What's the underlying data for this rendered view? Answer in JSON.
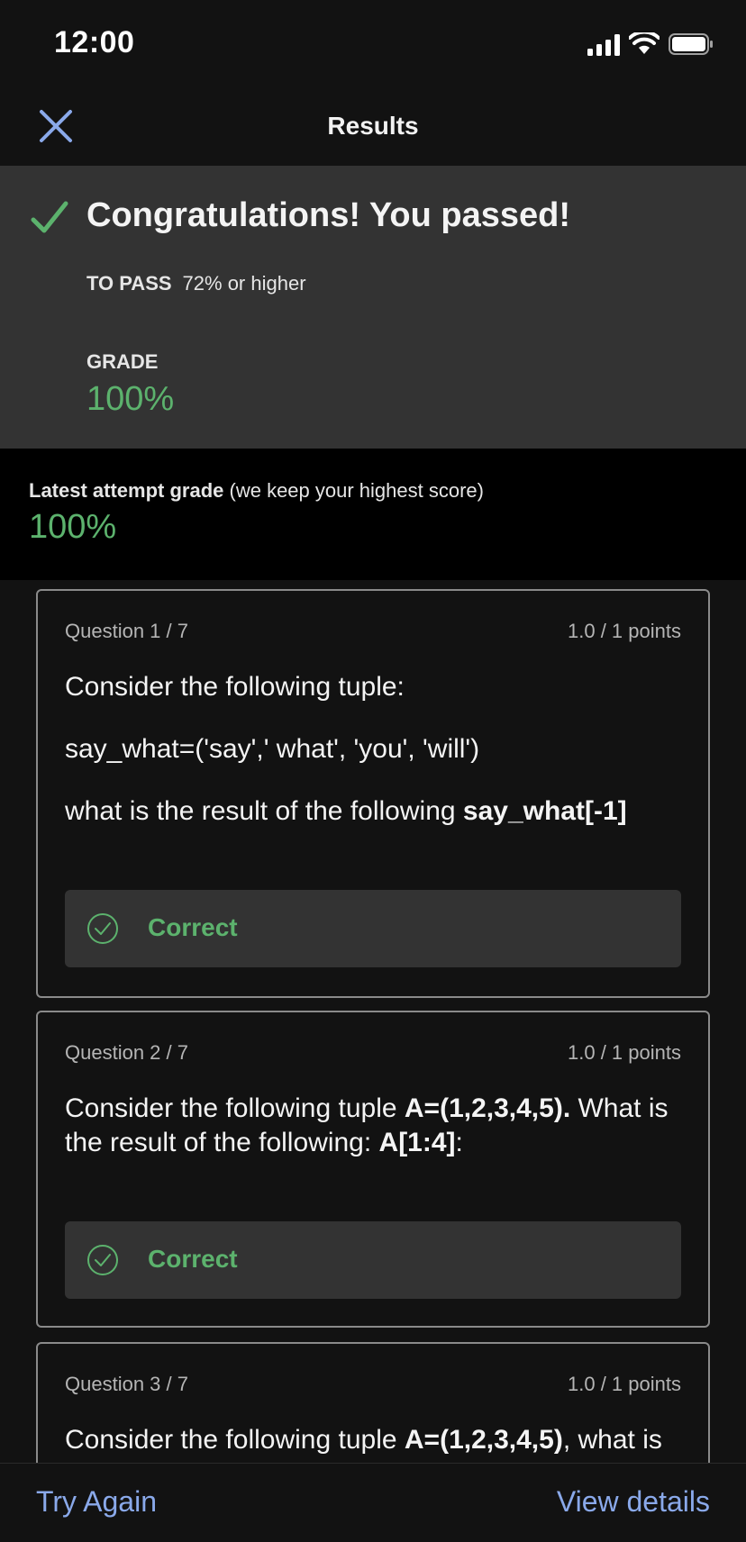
{
  "status_bar": {
    "time": "12:00"
  },
  "nav": {
    "title": "Results"
  },
  "summary": {
    "headline": "Congratulations! You passed!",
    "to_pass_label": "TO PASS",
    "to_pass_value": "72% or higher",
    "grade_label": "GRADE",
    "grade_value": "100%"
  },
  "latest": {
    "label": "Latest attempt grade",
    "note": " (we keep your highest score)",
    "value": "100%"
  },
  "questions": [
    {
      "number": "Question 1 / 7",
      "points": "1.0 / 1 points",
      "line1": "Consider the following tuple:",
      "line2": "say_what=('say',' what', 'you', 'will')",
      "line3_text": "what is the result of the following ",
      "line3_bold": "say_what[-1]",
      "result": "Correct"
    },
    {
      "number": "Question 2 / 7",
      "points": "1.0 / 1 points",
      "text_a": "Consider the following tuple ",
      "bold_a": "A=(1,2,3,4,5).",
      "text_b": " What is the result of the following: ",
      "bold_b": "A[1:4]",
      "text_c": ":",
      "result": "Correct"
    },
    {
      "number": "Question 3 / 7",
      "points": "1.0 / 1 points",
      "text_a": "Consider the following tuple ",
      "bold_a": "A=(1,2,3,4,5)",
      "text_b": ", what is"
    }
  ],
  "bottom": {
    "try_again": "Try Again",
    "view_details": "View details"
  },
  "colors": {
    "accent_green": "#5cb26d",
    "link_blue": "#8aa9ea",
    "background": "#121212",
    "panel": "#333333"
  },
  "icons": [
    "signal-icon",
    "wifi-icon",
    "battery-icon",
    "close-icon",
    "checkmark-icon",
    "check-circle-icon"
  ]
}
